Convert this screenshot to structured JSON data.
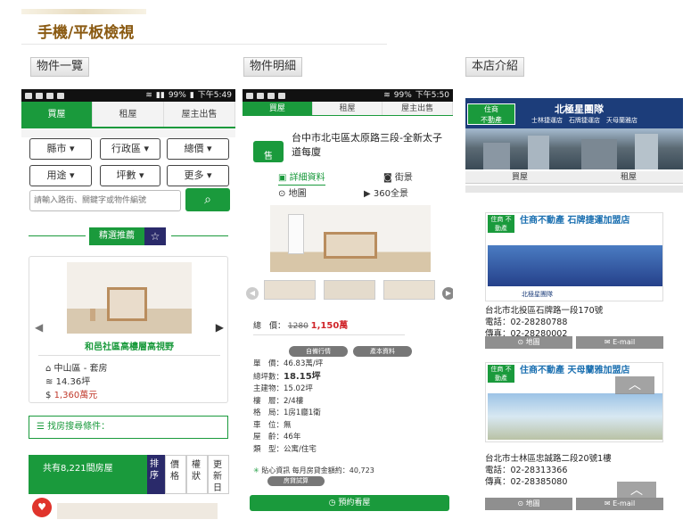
{
  "header": {
    "title": "手機/平板檢視"
  },
  "labels": {
    "list": "物件一覽",
    "detail": "物件明細",
    "store": "本店介紹"
  },
  "status": {
    "battery1": "99%",
    "time1": "下午5:49",
    "battery2": "99%",
    "time2": "下午5:50",
    "signal": "4G"
  },
  "tabs": [
    "買屋",
    "租屋",
    "屋主出售"
  ],
  "filters": [
    "縣市 ▾",
    "行政區 ▾",
    "總價 ▾",
    "用途 ▾",
    "坪數 ▾",
    "更多 ▾"
  ],
  "search": {
    "placeholder": "請輸入路街、關鍵字或物件編號"
  },
  "featured": {
    "label": "精選推薦",
    "title": "和邑社區高樓層高視野",
    "district": "中山區 - 套房",
    "area": "14.36坪",
    "price": "1,360萬元"
  },
  "search_cond": "找房搜尋條件：",
  "listbar": {
    "count": "共有8,221間房屋",
    "sort": "排序",
    "price": "價格",
    "pattern": "權狀",
    "newest": "更新日"
  },
  "detail": {
    "sale_tag": "售",
    "address": "台中市北屯區太原路三段-全新太子道每廈",
    "nav": [
      "詳細資料",
      "街景",
      "地圖",
      "360全景"
    ],
    "price_label": "總　價：",
    "old_price": "1280",
    "new_price": "1,150萬",
    "chips": [
      "自備行情",
      "產本資料"
    ],
    "rows": [
      {
        "k": "單　價：",
        "v": "46.83萬/坪"
      },
      {
        "k": "總坪數：",
        "v": "18.15坪"
      },
      {
        "k": "主建物：",
        "v": "15.02坪"
      },
      {
        "k": "樓　層：",
        "v": "2/4樓"
      },
      {
        "k": "格　局：",
        "v": "1房1廳1衛"
      },
      {
        "k": "車　位：",
        "v": "無"
      },
      {
        "k": "屋　齡：",
        "v": "46年"
      },
      {
        "k": "類　型：",
        "v": "公寓/住宅"
      }
    ],
    "loan": "貼心資訊 每月房貸金額約：40,723",
    "loan_btn": "房貸試算",
    "book": "預約看屋"
  },
  "store": {
    "banner_title": "北極星團隊",
    "banner_branches": "士林捷運店　石牌捷運店　天母蘭雅店",
    "tabs": [
      "買屋",
      "租屋"
    ],
    "stores": [
      {
        "brand": "住商 不動產",
        "name": "住商不動產 石牌捷運加盟店",
        "photo_brand": "北極星團隊",
        "address": "台北市北投區石牌路一段170號",
        "tel": "電話：02-28280788",
        "fax": "傳真：02-28280002"
      },
      {
        "brand": "住商 不動產",
        "name": "住商不動產 天母蘭雅加盟店",
        "address": "台北市士林區忠誠路二段20號1樓",
        "tel": "電話：02-28313366",
        "fax": "傳真：02-28385080"
      }
    ],
    "map": "地圖",
    "email": "E-mail"
  }
}
